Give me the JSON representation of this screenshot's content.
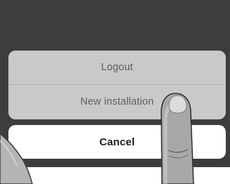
{
  "action_sheet": {
    "options": [
      {
        "label": "Logout"
      },
      {
        "label": "New installation"
      }
    ],
    "cancel_label": "Cancel"
  },
  "colors": {
    "screen_background": "#3d3d3d",
    "sheet_background": "#c9c9c9",
    "option_text": "#5e5e5e",
    "cancel_background": "#ffffff",
    "cancel_text": "#1e1e1e"
  },
  "icons": [
    "pointing-finger",
    "thumb"
  ]
}
